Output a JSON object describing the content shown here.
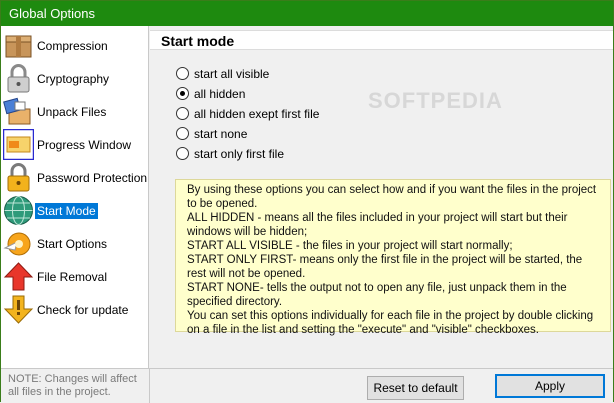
{
  "window": {
    "title": "Global Options"
  },
  "sidebar": {
    "items": [
      {
        "label": "Compression",
        "icon": "box-icon"
      },
      {
        "label": "Cryptography",
        "icon": "padlock-icon"
      },
      {
        "label": "Unpack Files",
        "icon": "unpack-icon"
      },
      {
        "label": "Progress Window",
        "icon": "progress-window-icon"
      },
      {
        "label": "Password Protection",
        "icon": "gold-lock-icon"
      },
      {
        "label": "Start Mode",
        "icon": "globe-icon",
        "selected": true
      },
      {
        "label": "Start Options",
        "icon": "start-options-icon"
      },
      {
        "label": "File Removal",
        "icon": "red-arrow-up-icon"
      },
      {
        "label": "Check for update",
        "icon": "warning-arrow-icon"
      }
    ]
  },
  "main": {
    "header": "Start mode",
    "watermark": "SOFTPEDIA",
    "options": [
      {
        "label": "start all visible",
        "checked": false
      },
      {
        "label": "all hidden",
        "checked": true
      },
      {
        "label": "all hidden exept first file",
        "checked": false
      },
      {
        "label": "start none",
        "checked": false
      },
      {
        "label": "start only first file",
        "checked": false
      }
    ],
    "info": [
      "By using these options you can select how and if you want the files in the project to be opened.",
      "ALL HIDDEN - means all the files included in your project will start but their windows will be hidden;",
      "START ALL VISIBLE - the files in your project will start normally;",
      "START ONLY FIRST- means only the first file in the project will be started, the rest will not be opened.",
      "START NONE- tells the output not to open any file, just unpack them in the specified directory.",
      "You can set this options individually for each file in the project by double clicking on a file in the list and setting the \"execute\" and \"visible\" checkboxes."
    ]
  },
  "footer": {
    "note": "NOTE: Changes will affect all files in the project.",
    "reset_label": "Reset to default",
    "apply_label": "Apply"
  },
  "colors": {
    "titlebar": "#1e8a0f",
    "selection": "#0078d7",
    "info_bg": "#ffffcc"
  }
}
